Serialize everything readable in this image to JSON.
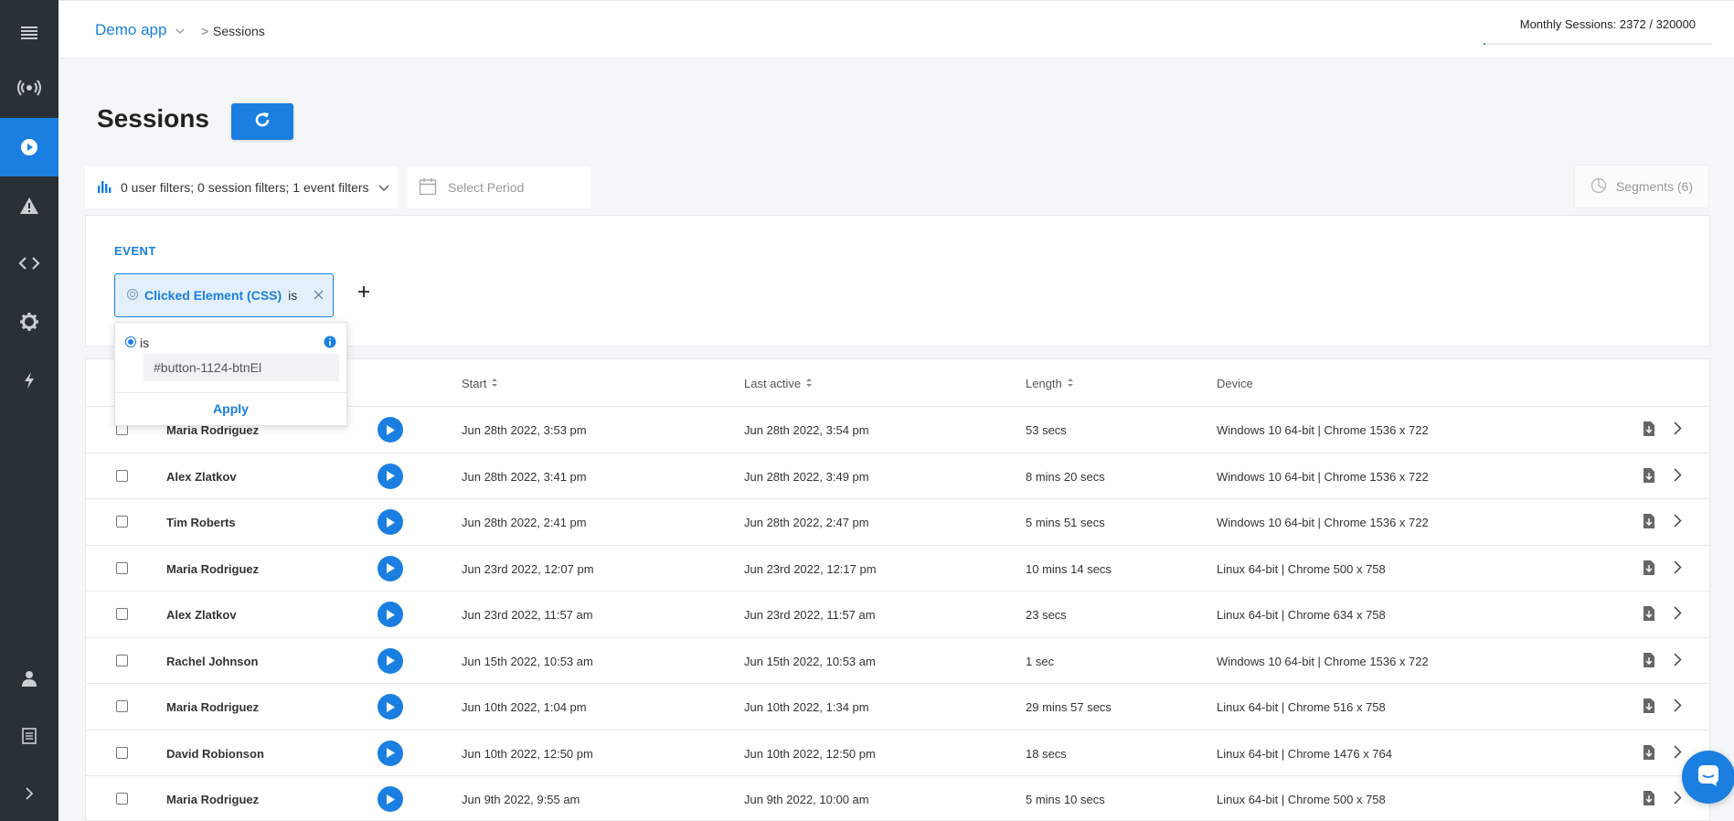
{
  "sidebar": {
    "items": [
      {
        "icon": "menu-icon"
      },
      {
        "icon": "broadcast-icon"
      },
      {
        "icon": "play-circle-icon",
        "active": true
      },
      {
        "icon": "warning-icon"
      },
      {
        "icon": "code-icon"
      },
      {
        "icon": "gear-icon"
      },
      {
        "icon": "lightning-icon"
      },
      {
        "icon": "user-icon"
      },
      {
        "icon": "document-icon"
      },
      {
        "icon": "expand-chevron-icon"
      }
    ]
  },
  "header": {
    "app_name": "Demo app",
    "separator": ">",
    "current": "Sessions",
    "monthly_sessions": "Monthly Sessions: 2372 / 320000",
    "monthly_usage_fraction": 0.0074
  },
  "page": {
    "title": "Sessions"
  },
  "filters": {
    "summary": "0 user filters; 0 session filters; 1 event filters",
    "period_placeholder": "Select Period",
    "segments_label": "Segments (6)"
  },
  "event_panel": {
    "label": "EVENT",
    "chip_name": "Clicked Element (CSS)",
    "chip_operator": "is"
  },
  "popup": {
    "radio_label": "is",
    "input_value": "#button-1124-btnEl",
    "apply_label": "Apply"
  },
  "table": {
    "columns": {
      "start": "Start",
      "last_active": "Last active",
      "length": "Length",
      "device": "Device"
    },
    "rows": [
      {
        "user": "Maria Rodriguez",
        "start": "Jun 28th 2022, 3:53 pm",
        "last": "Jun 28th 2022, 3:54 pm",
        "length": "53 secs",
        "device": "Windows 10 64-bit | Chrome 1536 x 722"
      },
      {
        "user": "Alex Zlatkov",
        "start": "Jun 28th 2022, 3:41 pm",
        "last": "Jun 28th 2022, 3:49 pm",
        "length": "8 mins 20 secs",
        "device": "Windows 10 64-bit | Chrome 1536 x 722"
      },
      {
        "user": "Tim Roberts",
        "start": "Jun 28th 2022, 2:41 pm",
        "last": "Jun 28th 2022, 2:47 pm",
        "length": "5 mins 51 secs",
        "device": "Windows 10 64-bit | Chrome 1536 x 722"
      },
      {
        "user": "Maria Rodriguez",
        "start": "Jun 23rd 2022, 12:07 pm",
        "last": "Jun 23rd 2022, 12:17 pm",
        "length": "10 mins 14 secs",
        "device": "Linux 64-bit | Chrome 500 x 758"
      },
      {
        "user": "Alex Zlatkov",
        "start": "Jun 23rd 2022, 11:57 am",
        "last": "Jun 23rd 2022, 11:57 am",
        "length": "23 secs",
        "device": "Linux 64-bit | Chrome 634 x 758"
      },
      {
        "user": "Rachel Johnson",
        "start": "Jun 15th 2022, 10:53 am",
        "last": "Jun 15th 2022, 10:53 am",
        "length": "1 sec",
        "device": "Windows 10 64-bit | Chrome 1536 x 722"
      },
      {
        "user": "Maria Rodriguez",
        "start": "Jun 10th 2022, 1:04 pm",
        "last": "Jun 10th 2022, 1:34 pm",
        "length": "29 mins 57 secs",
        "device": "Linux 64-bit | Chrome 516 x 758"
      },
      {
        "user": "David Robionson",
        "start": "Jun 10th 2022, 12:50 pm",
        "last": "Jun 10th 2022, 12:50 pm",
        "length": "18 secs",
        "device": "Linux 64-bit | Chrome 1476 x 764"
      },
      {
        "user": "Maria Rodriguez",
        "start": "Jun 9th 2022, 9:55 am",
        "last": "Jun 9th 2022, 10:00 am",
        "length": "5 mins 10 secs",
        "device": "Linux 64-bit | Chrome 500 x 758"
      }
    ]
  },
  "colors": {
    "accent": "#1a7fe0",
    "sidebar": "#293036",
    "progress": "#1aa37a"
  }
}
